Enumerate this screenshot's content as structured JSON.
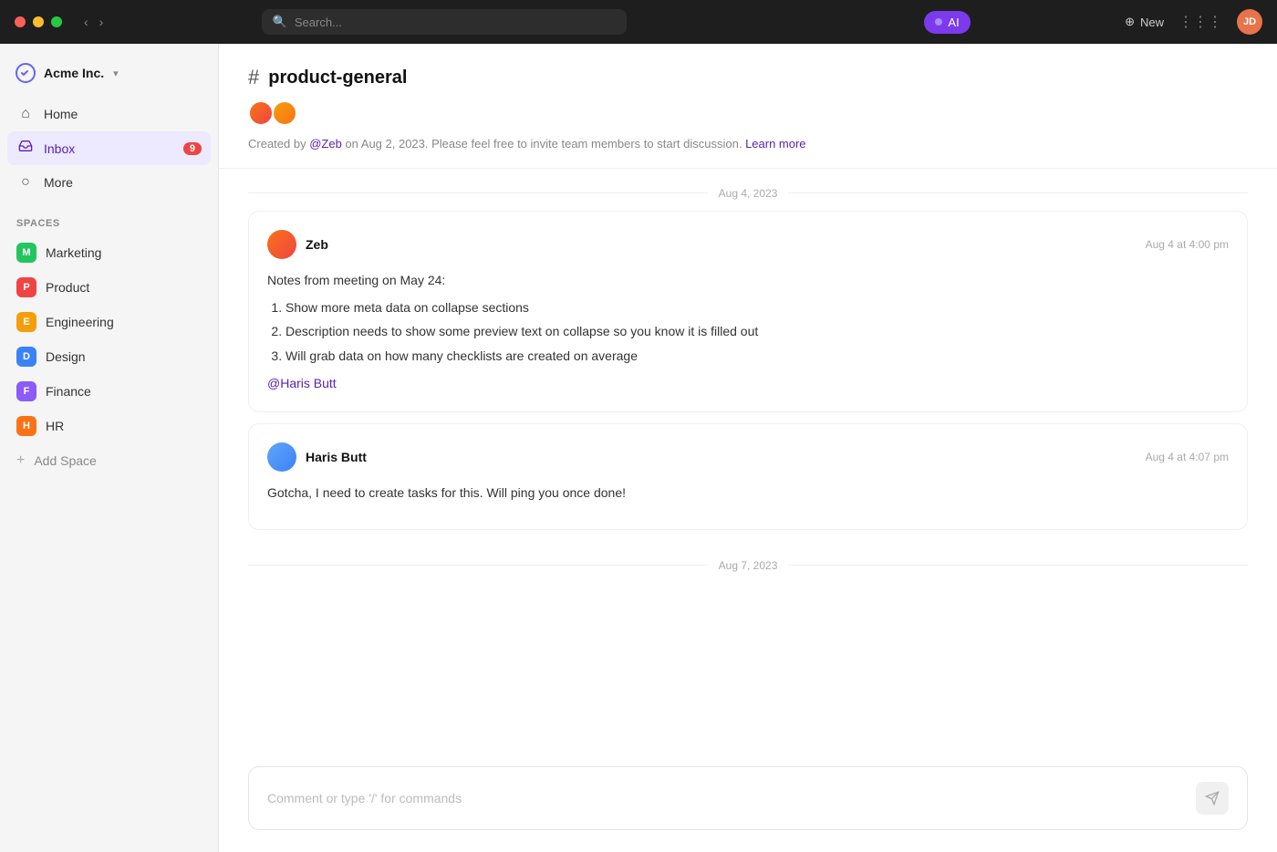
{
  "titlebar": {
    "search_placeholder": "Search...",
    "ai_label": "AI",
    "new_label": "New"
  },
  "sidebar": {
    "workspace_name": "Acme Inc.",
    "nav_items": [
      {
        "id": "home",
        "label": "Home",
        "icon": "⌂"
      },
      {
        "id": "inbox",
        "label": "Inbox",
        "icon": "✉",
        "badge": "9",
        "active": true
      },
      {
        "id": "more",
        "label": "More",
        "icon": "○"
      }
    ],
    "spaces_label": "Spaces",
    "spaces": [
      {
        "id": "marketing",
        "label": "Marketing",
        "initial": "M",
        "color": "#22c55e"
      },
      {
        "id": "product",
        "label": "Product",
        "initial": "P",
        "color": "#ef4444"
      },
      {
        "id": "engineering",
        "label": "Engineering",
        "initial": "E",
        "color": "#f59e0b"
      },
      {
        "id": "design",
        "label": "Design",
        "initial": "D",
        "color": "#3b82f6"
      },
      {
        "id": "finance",
        "label": "Finance",
        "initial": "F",
        "color": "#8b5cf6"
      },
      {
        "id": "hr",
        "label": "HR",
        "initial": "H",
        "color": "#f97316"
      }
    ],
    "add_space_label": "Add Space"
  },
  "channel": {
    "hash": "#",
    "name": "product-general",
    "description_prefix": "Created by ",
    "description_author": "@Zeb",
    "description_middle": " on Aug 2, 2023. Please feel free to invite team members to start discussion. ",
    "description_link": "Learn more"
  },
  "messages": [
    {
      "date_label": "Aug 4, 2023",
      "items": [
        {
          "id": "msg1",
          "author": "Zeb",
          "timestamp": "Aug 4 at 4:00 pm",
          "body_intro": "Notes from meeting on May 24:",
          "list_items": [
            "Show more meta data on collapse sections",
            "Description needs to show some preview text on collapse so you know it is filled out",
            "Will grab data on how many checklists are created on average"
          ],
          "mention": "@Haris Butt"
        },
        {
          "id": "msg2",
          "author": "Haris Butt",
          "timestamp": "Aug 4 at 4:07 pm",
          "body": "Gotcha, I need to create tasks for this. Will ping you once done!"
        }
      ]
    },
    {
      "date_label": "Aug 7, 2023",
      "items": []
    }
  ],
  "comment_box": {
    "placeholder": "Comment or type '/' for commands"
  }
}
